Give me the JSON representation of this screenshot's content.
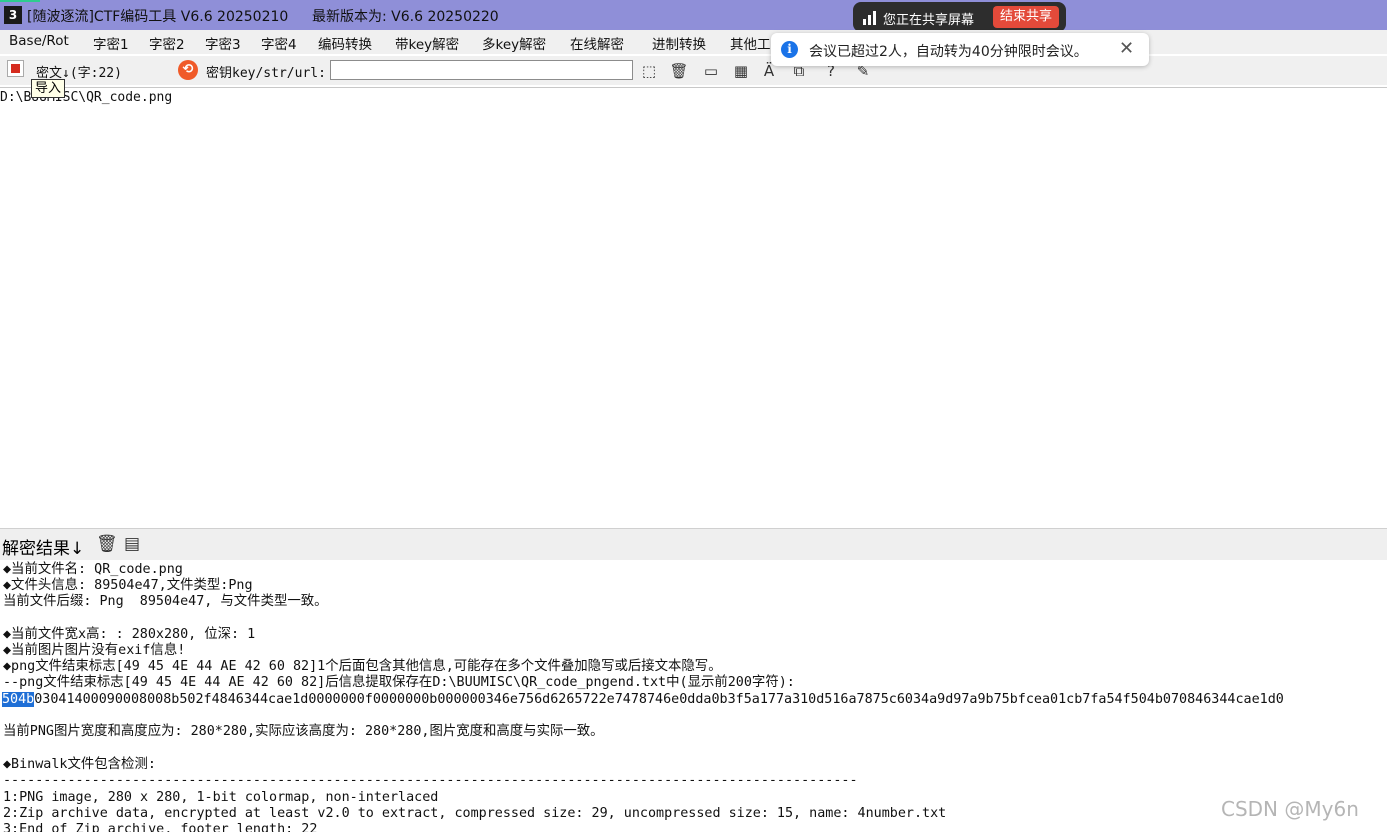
{
  "window": {
    "app_icon": "app-logo-icon",
    "title": "[随波逐流]CTF编码工具 V6.6 20250210",
    "latest_version": "最新版本为: V6.6 20250220"
  },
  "share": {
    "status": "您正在共享屏幕",
    "stop_label": "结束共享"
  },
  "toast": {
    "message": "会议已超过2人，自动转为40分钟限时会议。",
    "close": "✕"
  },
  "menu": {
    "items": [
      "Base/Rot",
      "字密1",
      "字密2",
      "字密3",
      "字密4",
      "编码转换",
      "带key解密",
      "多key解密",
      "在线解密",
      "进制转换",
      "其他工"
    ]
  },
  "toolbar": {
    "cipher_label": "密文↓(字:22)",
    "key_label": "密钥key/str/url:",
    "key_value": "",
    "tooltip": "导入"
  },
  "input": {
    "text": "D:\\BUUMISC\\QR_code.png"
  },
  "results": {
    "header": "解密结果↓",
    "lines": [
      "◆当前文件名: QR_code.png",
      "◆文件头信息: 89504e47,文件类型:Png",
      "当前文件后缀: Png  89504e47, 与文件类型一致。",
      "",
      "◆当前文件宽x高: : 280x280, 位深: 1",
      "◆当前图片图片没有exif信息!",
      "◆png文件结束标志[49 45 4E 44 AE 42 60 82]1个后面包含其他信息,可能存在多个文件叠加隐写或后接文本隐写。",
      "--png文件结束标志[49 45 4E 44 AE 42 60 82]后信息提取保存在D:\\BUUMISC\\QR_code_pngend.txt中(显示前200字符):",
      "",
      "",
      "当前PNG图片宽度和高度应为: 280*280,实际应该高度为: 280*280,图片宽度和高度与实际一致。",
      "",
      "◆Binwalk文件包含检测:",
      "----------------------------------------------------------------------------------------------------------",
      "1:PNG image, 280 x 280, 1-bit colormap, non-interlaced",
      "2:Zip archive data, encrypted at least v2.0 to extract, compressed size: 29, uncompressed size: 15, name: 4number.txt",
      "3:End of Zip archive, footer length: 22"
    ],
    "hex_selected": "504b",
    "hex_rest": "03041400090008008b502f4846344cae1d0000000f0000000b000000346e756d6265722e7478746e0dda0b3f5a177a310d516a7875c6034a9d97a9b75bfcea01cb7fa54f504b070846344cae1d0"
  },
  "watermark": "CSDN @My6n"
}
